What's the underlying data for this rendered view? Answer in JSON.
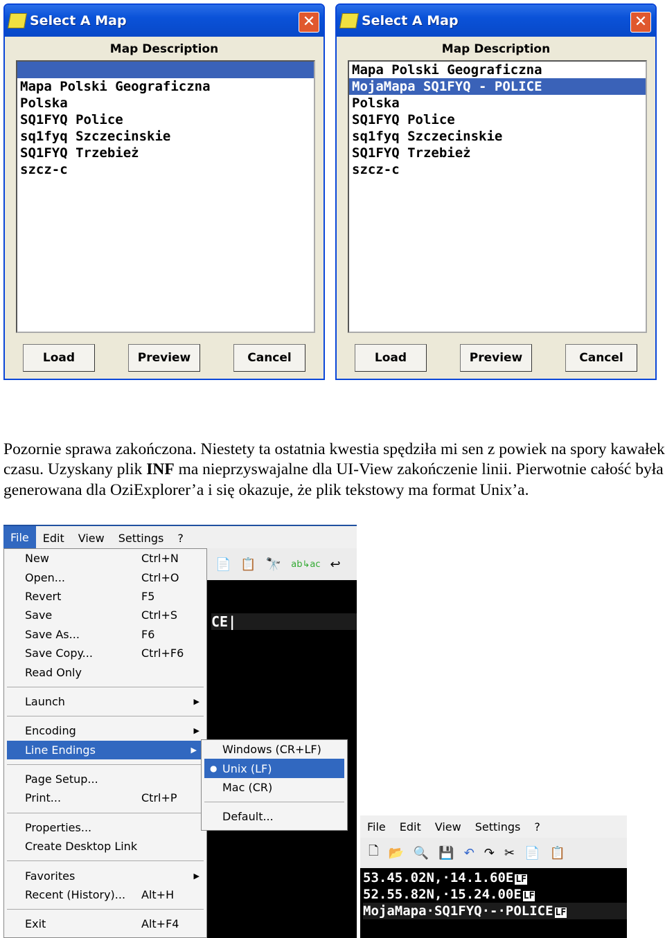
{
  "dialogs": [
    {
      "title": "Select A Map",
      "header": "Map Description",
      "items": [
        "",
        "Mapa Polski Geograficzna",
        "Polska",
        "SQ1FYQ Police",
        "sq1fyq Szczecinskie",
        "SQ1FYQ Trzebież",
        "szcz-c"
      ],
      "selected": 0,
      "buttons": [
        "Load",
        "Preview",
        "Cancel"
      ]
    },
    {
      "title": "Select A Map",
      "header": "Map Description",
      "items": [
        "Mapa Polski Geograficzna",
        "MojaMapa SQ1FYQ - POLICE",
        "Polska",
        "SQ1FYQ Police",
        "sq1fyq Szczecinskie",
        "SQ1FYQ Trzebież",
        "szcz-c"
      ],
      "selected": 1,
      "buttons": [
        "Load",
        "Preview",
        "Cancel"
      ]
    }
  ],
  "paragraph": {
    "p1": "Pozornie sprawa zakończona. Niestety ta ostatnia kwestia spędziła mi sen z powiek na spory kawałek czasu. Uzyskany plik ",
    "bold": "INF",
    "p2": " ma nieprzyswajalne dla UI-View zakończenie linii. Pierwotnie całość była generowana dla OziExplorer’a i się okazuje, że plik tekstowy ma format Unix’a."
  },
  "editor1": {
    "menubar": [
      "File",
      "Edit",
      "View",
      "Settings",
      "?"
    ],
    "file_menu": [
      {
        "label": "New",
        "shortcut": "Ctrl+N"
      },
      {
        "label": "Open...",
        "shortcut": "Ctrl+O"
      },
      {
        "label": "Revert",
        "shortcut": "F5"
      },
      {
        "label": "Save",
        "shortcut": "Ctrl+S"
      },
      {
        "label": "Save As...",
        "shortcut": "F6"
      },
      {
        "label": "Save Copy...",
        "shortcut": "Ctrl+F6"
      },
      {
        "label": "Read Only",
        "shortcut": ""
      },
      {
        "sep": true
      },
      {
        "label": "Launch",
        "shortcut": "",
        "submenu": true
      },
      {
        "sep": true
      },
      {
        "label": "Encoding",
        "shortcut": "",
        "submenu": true
      },
      {
        "label": "Line Endings",
        "shortcut": "",
        "submenu": true,
        "highlighted": true
      },
      {
        "sep": true
      },
      {
        "label": "Page Setup...",
        "shortcut": ""
      },
      {
        "label": "Print...",
        "shortcut": "Ctrl+P"
      },
      {
        "sep": true
      },
      {
        "label": "Properties...",
        "shortcut": ""
      },
      {
        "label": "Create Desktop Link",
        "shortcut": ""
      },
      {
        "sep": true
      },
      {
        "label": "Favorites",
        "shortcut": "",
        "submenu": true
      },
      {
        "label": "Recent (History)...",
        "shortcut": "Alt+H"
      },
      {
        "sep": true
      },
      {
        "label": "Exit",
        "shortcut": "Alt+F4"
      }
    ],
    "line_endings_submenu": [
      "Windows (CR+LF)",
      "Unix (LF)",
      "Mac (CR)",
      "Default..."
    ],
    "selected_line_ending": "Unix (LF)",
    "visible_text": "CE"
  },
  "editor2": {
    "menubar": [
      "File",
      "Edit",
      "View",
      "Settings",
      "?"
    ],
    "lines": [
      "53.45.02N,·14.1.60E",
      "52.55.82N,·15.24.00E",
      "MojaMapa·SQ1FYQ·-·POLICE"
    ],
    "eol_marker": "LF"
  }
}
